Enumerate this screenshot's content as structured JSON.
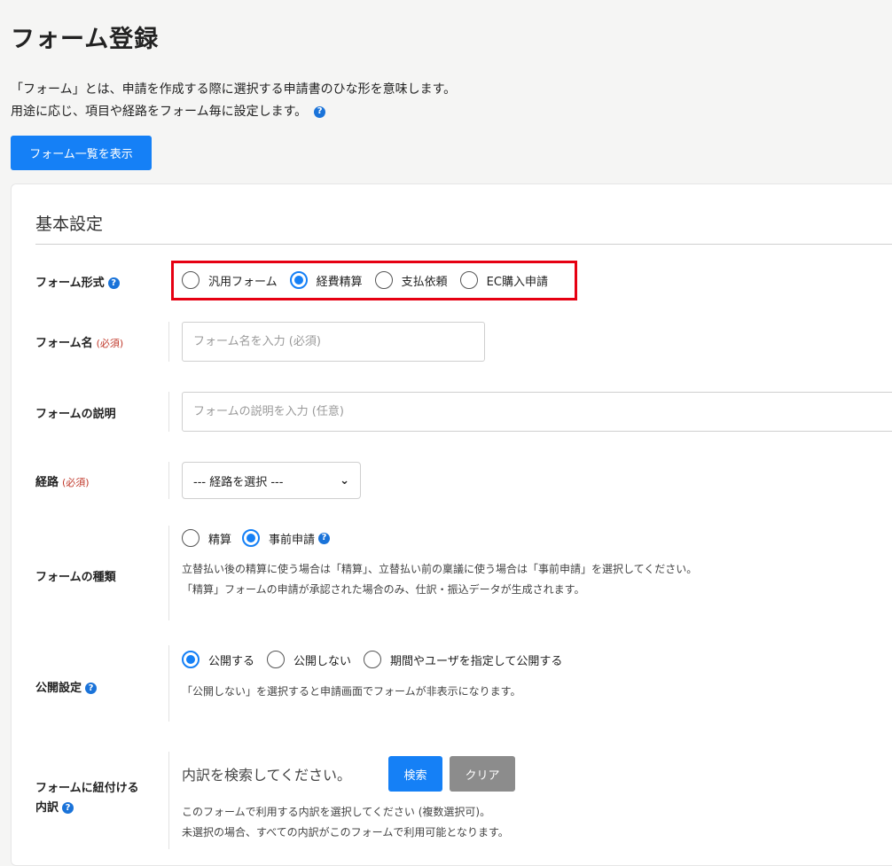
{
  "page": {
    "title": "フォーム登録",
    "intro_line1": "「フォーム」とは、申請を作成する際に選択する申請書のひな形を意味します。",
    "intro_line2": "用途に応じ、項目や経路をフォーム毎に設定します。",
    "list_button": "フォーム一覧を表示",
    "help_glyph": "?"
  },
  "section": {
    "title": "基本設定"
  },
  "form_type": {
    "label": "フォーム形式",
    "options": [
      "汎用フォーム",
      "経費精算",
      "支払依頼",
      "EC購入申請"
    ],
    "selected": "経費精算"
  },
  "form_name": {
    "label": "フォーム名",
    "required": "(必須)",
    "placeholder": "フォーム名を入力 (必須)"
  },
  "form_desc": {
    "label": "フォームの説明",
    "placeholder": "フォームの説明を入力 (任意)"
  },
  "route": {
    "label": "経路",
    "required": "(必須)",
    "selected": "--- 経路を選択 ---"
  },
  "form_kind": {
    "label": "フォームの種類",
    "options": [
      "精算",
      "事前申請"
    ],
    "selected": "事前申請",
    "note1": "立替払い後の精算に使う場合は「精算」、立替払い前の稟議に使う場合は「事前申請」を選択してください。",
    "note2": "「精算」フォームの申請が承認された場合のみ、仕訳・振込データが生成されます。"
  },
  "publish": {
    "label": "公開設定",
    "options": [
      "公開する",
      "公開しない",
      "期間やユーザを指定して公開する"
    ],
    "selected": "公開する",
    "note": "「公開しない」を選択すると申請画面でフォームが非表示になります。"
  },
  "breakdown": {
    "label_line1": "フォームに紐付ける",
    "label_line2": "内訳",
    "search_text": "内訳を検索してください。",
    "search_button": "検索",
    "clear_button": "クリア",
    "note1": "このフォームで利用する内訳を選択してください (複数選択可)。",
    "note2": "未選択の場合、すべての内訳がこのフォームで利用可能となります。"
  },
  "colors": {
    "accent": "#1580f6",
    "highlight": "#e60012",
    "required": "#c0392b"
  }
}
